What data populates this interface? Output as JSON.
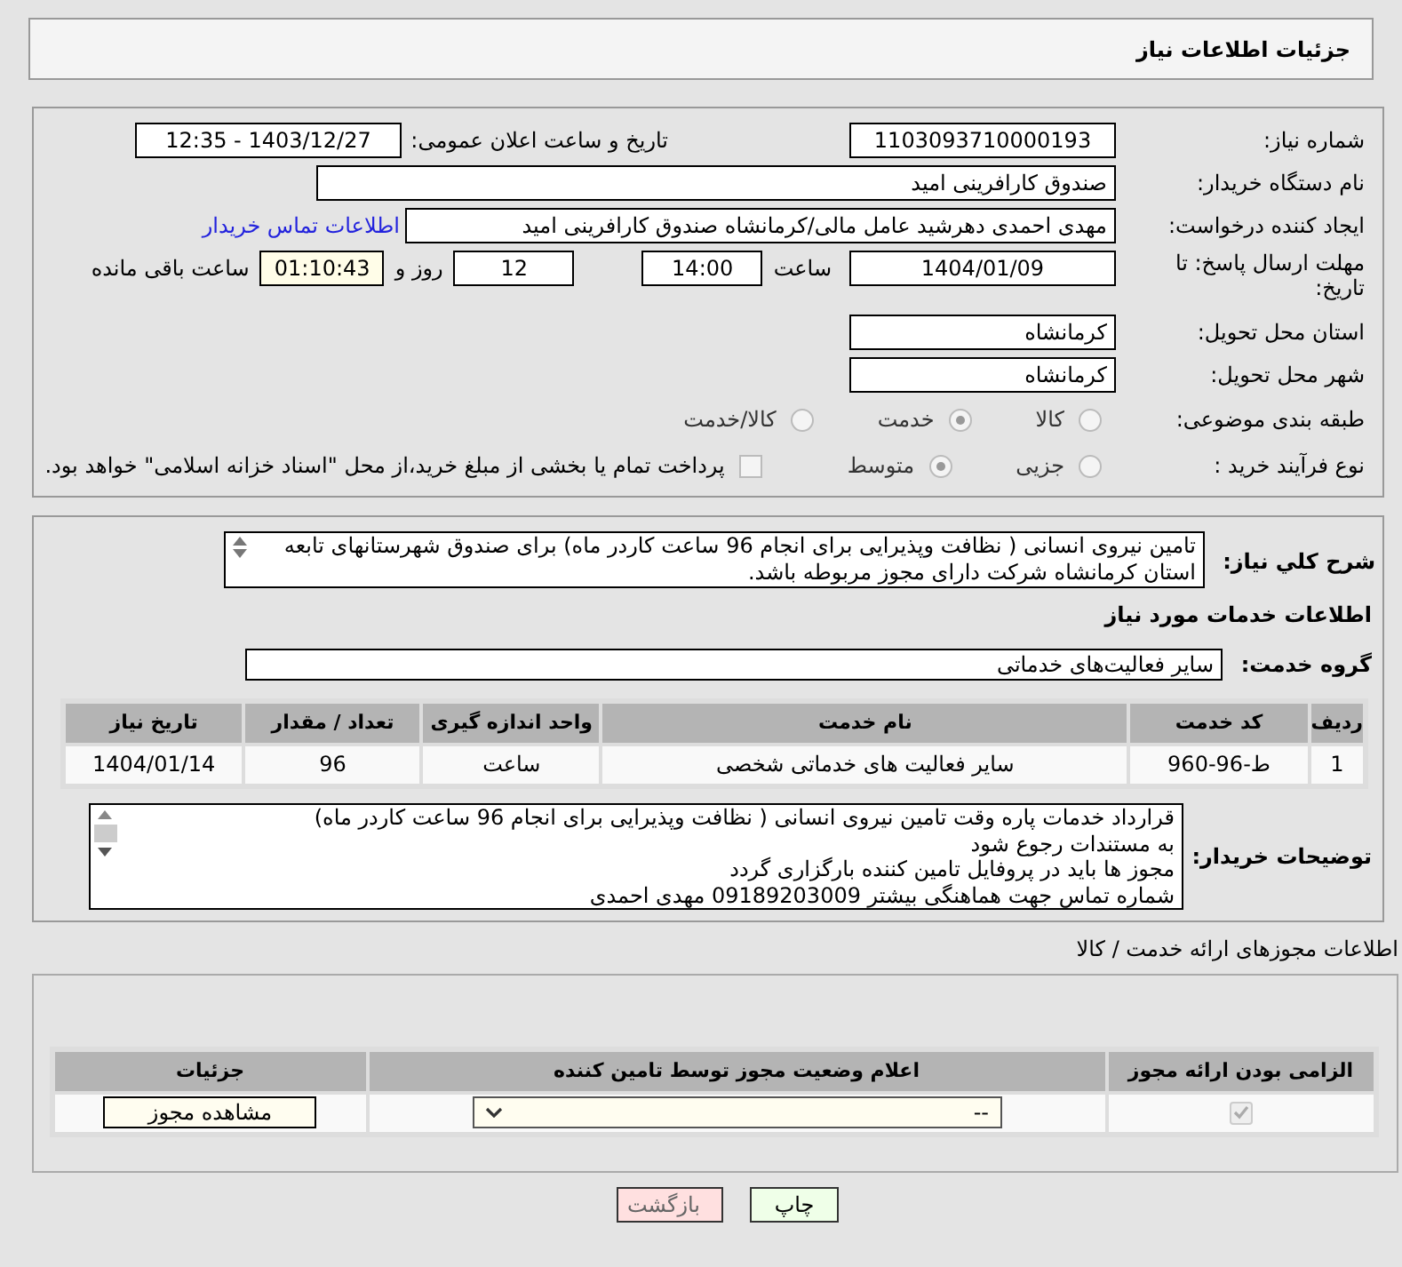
{
  "page_title": "جزئیات اطلاعات نیاز",
  "need_info": {
    "need_number": {
      "label": "شماره نیاز:",
      "value": "1103093710000193"
    },
    "announce": {
      "label": "تاریخ و ساعت اعلان عمومی:",
      "value": "1403/12/27 - 12:35"
    },
    "buyer_org": {
      "label": "نام دستگاه خریدار:",
      "value": "صندوق کارافرینی امید"
    },
    "requester": {
      "label": "ایجاد کننده درخواست:",
      "value": "مهدی احمدی دهرشید عامل مالی/کرمانشاه صندوق کارافرینی امید",
      "link": "اطلاعات تماس خریدار"
    },
    "deadline": {
      "label": "مهلت ارسال پاسخ: تا تاریخ:",
      "date": "1404/01/09",
      "time_label": "ساعت",
      "time": "14:00",
      "days": "12",
      "days_label": "روز و",
      "remaining": "01:10:43",
      "remaining_label": "ساعت باقی مانده"
    },
    "province": {
      "label": "استان محل تحویل:",
      "value": "کرمانشاه"
    },
    "city": {
      "label": "شهر محل تحویل:",
      "value": "کرمانشاه"
    },
    "category": {
      "label": "طبقه بندی موضوعی:",
      "options": [
        {
          "label": "کالا",
          "selected": false
        },
        {
          "label": "خدمت",
          "selected": true
        },
        {
          "label": "کالا/خدمت",
          "selected": false
        }
      ]
    },
    "process": {
      "label": "نوع فرآیند خرید :",
      "options": [
        {
          "label": "جزیی",
          "selected": false
        },
        {
          "label": "متوسط",
          "selected": true
        }
      ],
      "payment": {
        "label": "پرداخت تمام یا بخشی از مبلغ خرید،از محل \"اسناد خزانه اسلامی\" خواهد بود.",
        "checked": false
      }
    }
  },
  "services": {
    "description": {
      "label": "شرح کلي نياز:",
      "lines": [
        "تامین نیروی انسانی ( نظافت وپذیرایی برای انجام 96 ساعت کاردر ماه) برای صندوق شهرستانهای تابعه",
        "استان کرمانشاه شرکت دارای مجوز مربوطه باشد."
      ]
    },
    "heading": "اطلاعات خدمات مورد نیاز",
    "group": {
      "label": "گروه خدمت:",
      "value": "سایر فعالیت‌های خدماتی"
    },
    "table": {
      "columns": [
        "ردیف",
        "کد خدمت",
        "نام خدمت",
        "واحد اندازه گیری",
        "تعداد / مقدار",
        "تاریخ نیاز"
      ],
      "rows": [
        [
          "1",
          "ط-96-960",
          "سایر فعالیت های خدماتی شخصی",
          "ساعت",
          "96",
          "1404/01/14"
        ]
      ]
    },
    "buyer_notes": {
      "label": "توضیحات خریدار:",
      "lines": [
        "قرارداد خدمات پاره وقت تامین نیروی انسانی ( نظافت وپذیرایی برای انجام 96 ساعت کاردر ماه)",
        "به مستندات رجوع شود",
        "مجوز ها باید در پروفایل تامین کننده بارگزاری گردد",
        "شماره تماس جهت هماهنگی بیشتر 09189203009 مهدی احمدی"
      ]
    }
  },
  "permits": {
    "title": "اطلاعات مجوزهای ارائه خدمت / کالا",
    "columns": [
      "الزامی بودن ارائه مجوز",
      "اعلام وضعیت مجوز توسط تامین کننده",
      "جزئیات"
    ],
    "rows": [
      {
        "required": true,
        "status": "--",
        "details_button": "مشاهده مجوز"
      }
    ]
  },
  "buttons": [
    {
      "label": "چاپ",
      "kind": "print"
    },
    {
      "label": "بازگشت",
      "kind": "back"
    }
  ]
}
